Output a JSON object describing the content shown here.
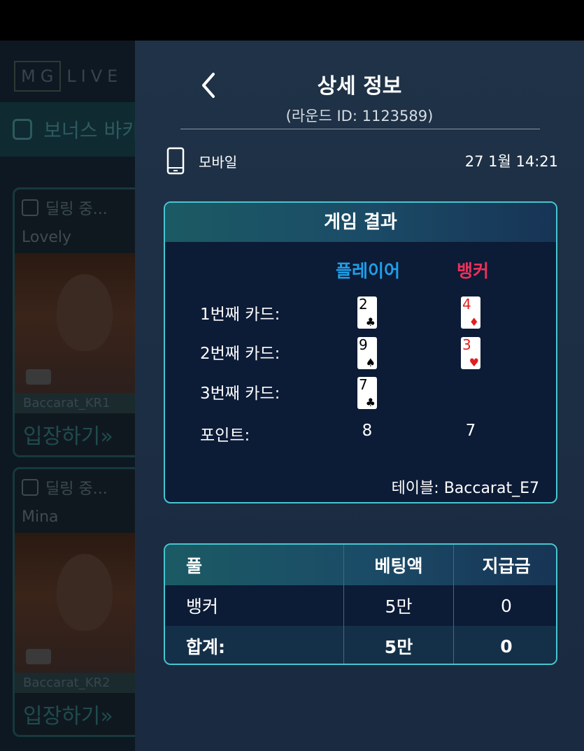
{
  "lobby": {
    "logo_left": "MG",
    "logo_right": "LIVE",
    "bonus_label": "보너스 바카",
    "tiles": [
      {
        "status": "딜링 중...",
        "dealer": "Lovely",
        "table": "Baccarat_KR1",
        "enter": "입장하기»"
      },
      {
        "status": "딜링 중...",
        "dealer": "Mina",
        "table": "Baccarat_KR2",
        "enter": "입장하기»"
      }
    ]
  },
  "detail": {
    "title": "상세 정보",
    "round": "(라운드 ID: 1123589)",
    "device": "모바일",
    "time": "27  1월 14:21",
    "result": {
      "header": "게임 결과",
      "player_label": "플레이어",
      "banker_label": "뱅커",
      "rows": [
        {
          "label": "1번째  카드:",
          "player": {
            "rank": "2",
            "suit": "♣",
            "color": "black"
          },
          "banker": {
            "rank": "4",
            "suit": "♦",
            "color": "red"
          }
        },
        {
          "label": "2번째 카드:",
          "player": {
            "rank": "9",
            "suit": "♠",
            "color": "black"
          },
          "banker": {
            "rank": "3",
            "suit": "♥",
            "color": "red"
          }
        },
        {
          "label": "3번째 카드:",
          "player": {
            "rank": "7",
            "suit": "♣",
            "color": "black"
          },
          "banker": null
        }
      ],
      "points_label": "포인트:",
      "player_points": "8",
      "banker_points": "7",
      "table": "테이블: Baccarat_E7"
    },
    "bets": {
      "headers": [
        "풀",
        "베팅액",
        "지급금"
      ],
      "rows": [
        [
          "뱅커",
          "5만",
          "0"
        ]
      ],
      "total": [
        "합계:",
        "5만",
        "0"
      ]
    }
  },
  "colors": {
    "player": "#1f9ee8",
    "banker": "#e8325a",
    "border": "#46c6d0"
  }
}
